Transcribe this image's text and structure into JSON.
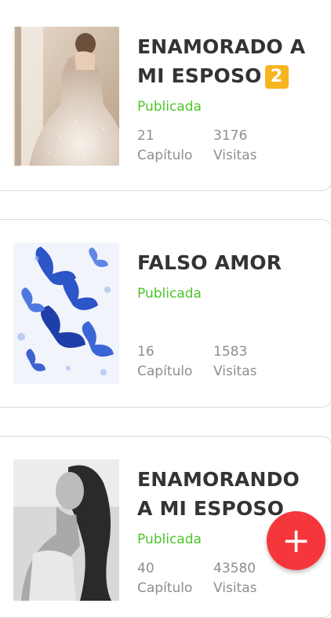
{
  "stories": [
    {
      "title_line1": "ENAMORADO A",
      "title_line2": "MI ESPOSO",
      "badge": "2",
      "status": "Publicada",
      "chapters": "21",
      "chapters_label": "Capítulo",
      "visits": "3176",
      "visits_label": "Visitas"
    },
    {
      "title_line1": "FALSO AMOR",
      "status": "Publicada",
      "chapters": "16",
      "chapters_label": "Capítulo",
      "visits": "1583",
      "visits_label": "Visitas"
    },
    {
      "title_line1": "ENAMORANDO",
      "title_line2": "A MI ESPOSO",
      "status": "Publicada",
      "chapters": "40",
      "chapters_label": "Capítulo",
      "visits": "43580",
      "visits_label": "Visitas"
    }
  ],
  "fab": {
    "icon": "plus-icon",
    "symbol": "+"
  },
  "colors": {
    "published": "#4fc42c",
    "fab": "#f5373c",
    "title": "#333333",
    "stat": "#8e8e8e"
  }
}
